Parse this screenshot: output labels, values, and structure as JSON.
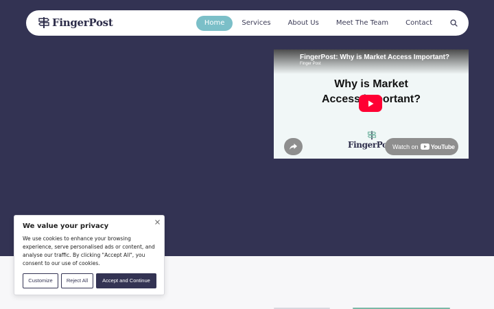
{
  "brand": {
    "name": "FingerPost",
    "color": "#2d2d4a"
  },
  "nav": {
    "items": [
      {
        "label": "Home",
        "active": true
      },
      {
        "label": "Services",
        "active": false
      },
      {
        "label": "About Us",
        "active": false
      },
      {
        "label": "Meet The Team",
        "active": false
      },
      {
        "label": "Contact",
        "active": false
      }
    ],
    "search_icon": "search-icon",
    "active_color": "#7bbfc8"
  },
  "hero": {
    "background": "#333353"
  },
  "video": {
    "title": "FingerPost: Why is Market Access Important?",
    "channel": "Finger Post",
    "headline_line1": "Why is Market",
    "headline_line2": "Access important?",
    "logo_text": "FingerPost",
    "watch_label": "Watch on",
    "youtube_word": "YouTube",
    "play_icon": "youtube-play-icon",
    "share_icon": "share-icon"
  },
  "cookie": {
    "title": "We value your privacy",
    "text": "We use cookies to enhance your browsing experience, serve personalised ads or content, and analyse our traffic. By clicking \"Accept All\", you consent to our use of cookies.",
    "customize_label": "Customize",
    "reject_label": "Reject All",
    "accept_label": "Accept and Continue",
    "close_icon": "close-icon"
  }
}
